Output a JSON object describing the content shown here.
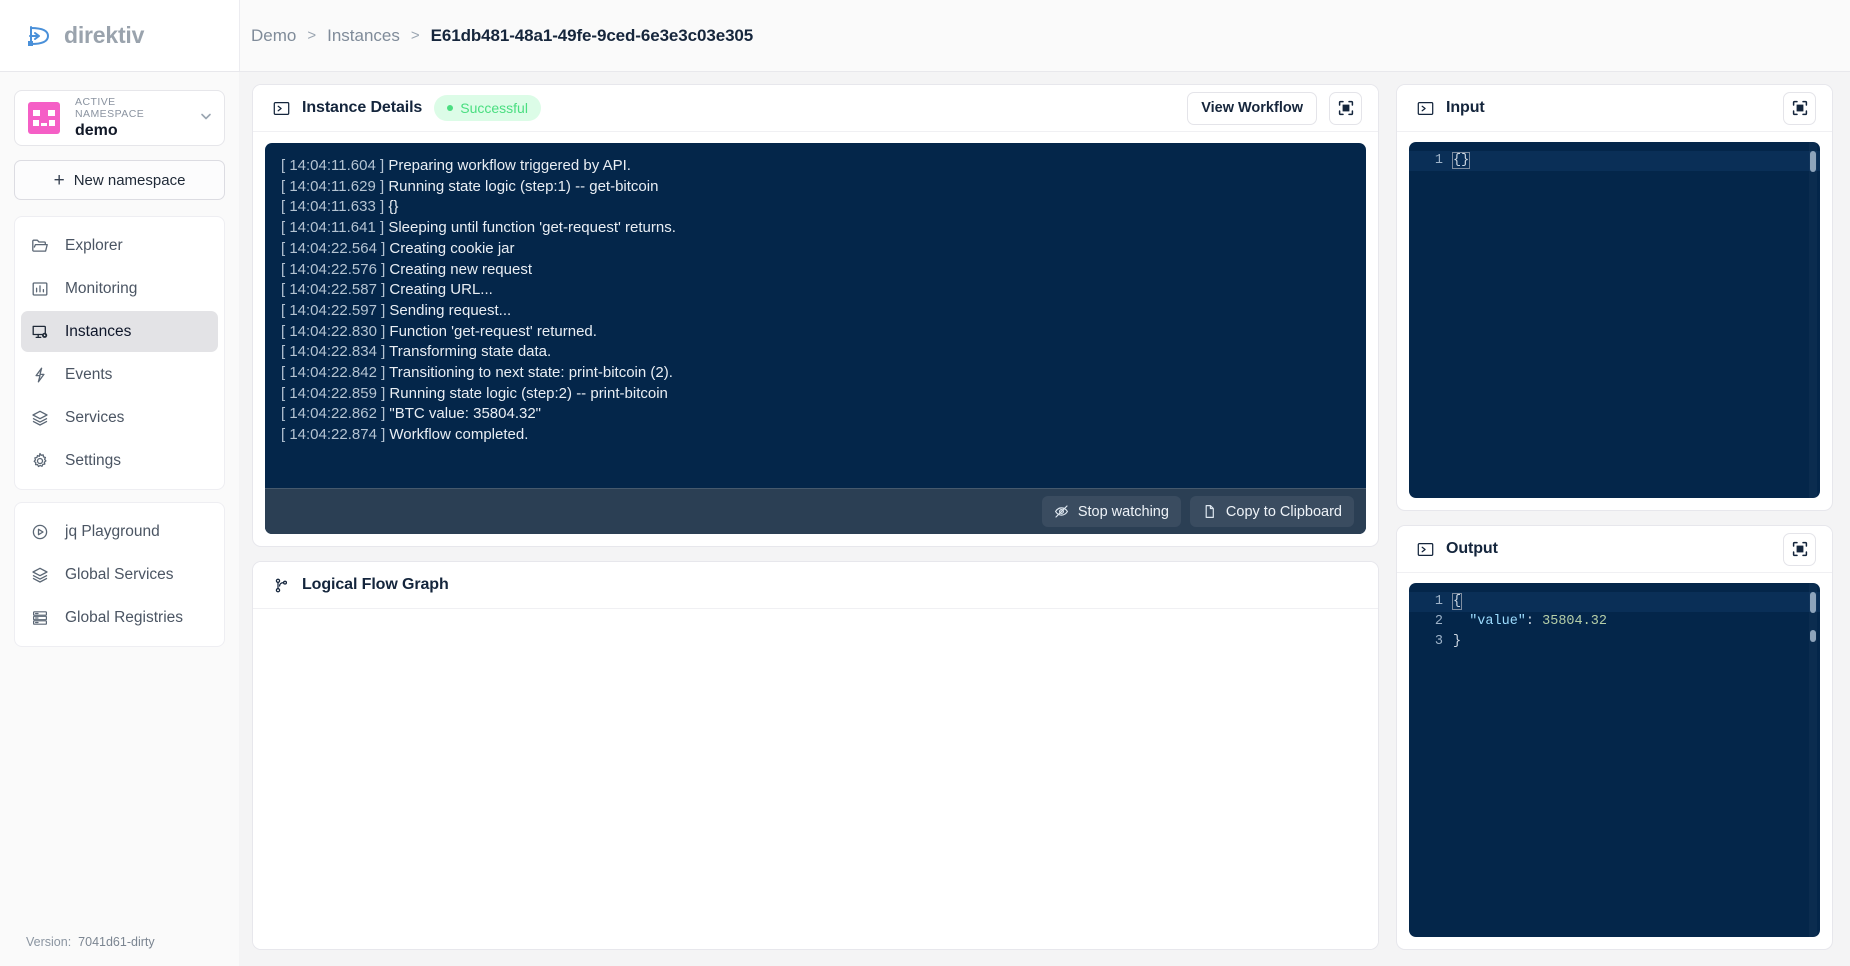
{
  "brand": {
    "name": "direktiv",
    "logo_icon": "direktiv-logo-icon"
  },
  "breadcrumb": {
    "root": "Demo",
    "section": "Instances",
    "current": "E61db481-48a1-49fe-9ced-6e3e3c03e305",
    "separator": ">"
  },
  "sidebar": {
    "namespace": {
      "label": "ACTIVE NAMESPACE",
      "name": "demo",
      "chevron_icon": "chevron-down-icon",
      "avatar_icon": "namespace-avatar",
      "avatar_color": "#f55fc6"
    },
    "new_namespace": {
      "label": "New namespace",
      "icon": "plus-icon"
    },
    "primary_items": [
      {
        "label": "Explorer",
        "icon": "folder-icon",
        "active": false
      },
      {
        "label": "Monitoring",
        "icon": "bar-chart-icon",
        "active": false
      },
      {
        "label": "Instances",
        "icon": "monitor-play-icon",
        "active": true
      },
      {
        "label": "Events",
        "icon": "zap-icon",
        "active": false
      },
      {
        "label": "Services",
        "icon": "layers-icon",
        "active": false
      },
      {
        "label": "Settings",
        "icon": "gear-icon",
        "active": false
      }
    ],
    "secondary_items": [
      {
        "label": "jq Playground",
        "icon": "play-circle-icon",
        "active": false
      },
      {
        "label": "Global Services",
        "icon": "layers-icon",
        "active": false
      },
      {
        "label": "Global Registries",
        "icon": "server-icon",
        "active": false
      }
    ],
    "version": {
      "label": "Version:",
      "value": "7041d61-dirty"
    }
  },
  "instance_details": {
    "title": "Instance Details",
    "title_icon": "terminal-icon",
    "status": {
      "label": "Successful",
      "color": "#4ade80",
      "bg": "#dcfce7"
    },
    "view_workflow_label": "View Workflow",
    "maximize_icon": "maximize-icon",
    "logs": [
      {
        "time": "[ 14:04:11.604 ]",
        "message": "Preparing workflow triggered by API."
      },
      {
        "time": "[ 14:04:11.629 ]",
        "message": "Running state logic (step:1) -- get-bitcoin"
      },
      {
        "time": "[ 14:04:11.633 ]",
        "message": "{}"
      },
      {
        "time": "[ 14:04:11.641 ]",
        "message": "Sleeping until function 'get-request' returns."
      },
      {
        "time": "[ 14:04:22.564 ]",
        "message": "Creating cookie jar"
      },
      {
        "time": "[ 14:04:22.576 ]",
        "message": "Creating new request"
      },
      {
        "time": "[ 14:04:22.587 ]",
        "message": "Creating URL..."
      },
      {
        "time": "[ 14:04:22.597 ]",
        "message": "Sending request..."
      },
      {
        "time": "[ 14:04:22.830 ]",
        "message": "Function 'get-request' returned."
      },
      {
        "time": "[ 14:04:22.834 ]",
        "message": "Transforming state data."
      },
      {
        "time": "[ 14:04:22.842 ]",
        "message": "Transitioning to next state: print-bitcoin (2)."
      },
      {
        "time": "[ 14:04:22.859 ]",
        "message": "Running state logic (step:2) -- print-bitcoin"
      },
      {
        "time": "[ 14:04:22.862 ]",
        "message": "\"BTC value: 35804.32\""
      },
      {
        "time": "[ 14:04:22.874 ]",
        "message": "Workflow completed."
      }
    ],
    "stop_watching_label": "Stop  watching",
    "stop_watching_icon": "eye-off-icon",
    "copy_label": "Copy  to Clipboard",
    "copy_icon": "copy-icon"
  },
  "flow_graph": {
    "title": "Logical Flow Graph",
    "title_icon": "git-branch-icon"
  },
  "input_panel": {
    "title": "Input",
    "title_icon": "terminal-icon",
    "maximize_icon": "maximize-icon",
    "lines": [
      {
        "number": "1",
        "content": "{}",
        "current": true
      }
    ]
  },
  "output_panel": {
    "title": "Output",
    "title_icon": "terminal-icon",
    "maximize_icon": "maximize-icon",
    "lines": [
      {
        "number": "1",
        "content": "{",
        "current": true
      },
      {
        "number": "2",
        "key": "\"value\"",
        "colon": ": ",
        "value": "35804.32",
        "indent": "  ",
        "current": false
      },
      {
        "number": "3",
        "content": "}",
        "current": false
      }
    ]
  }
}
